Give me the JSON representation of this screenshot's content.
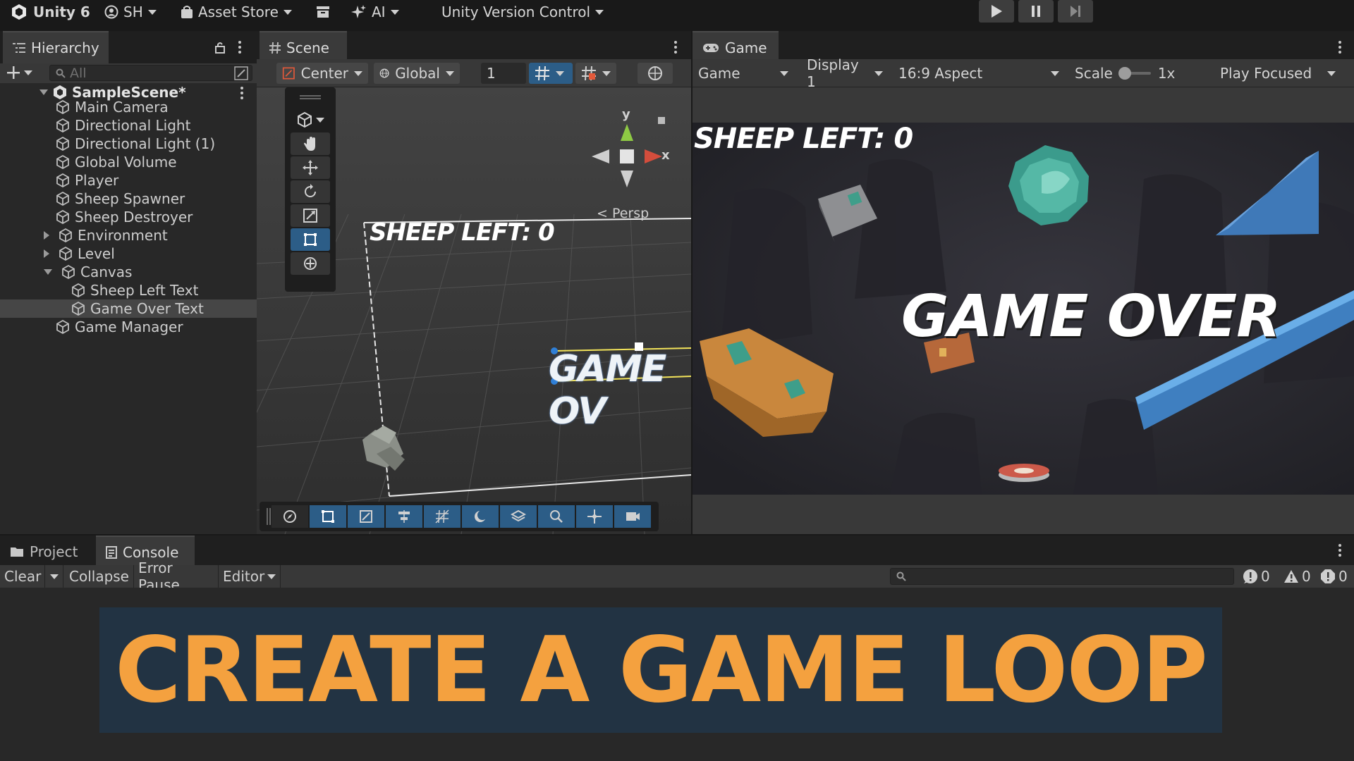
{
  "topbar": {
    "app_label": "Unity 6",
    "account_label": "SH",
    "asset_store_label": "Asset Store",
    "ai_label": "AI",
    "version_control_label": "Unity Version Control"
  },
  "hierarchy": {
    "tab_label": "Hierarchy",
    "search_placeholder": "All",
    "scene_name": "SampleScene*",
    "items": [
      {
        "label": "Main Camera"
      },
      {
        "label": "Directional Light"
      },
      {
        "label": "Directional Light (1)"
      },
      {
        "label": "Global Volume"
      },
      {
        "label": "Player"
      },
      {
        "label": "Sheep Spawner"
      },
      {
        "label": "Sheep Destroyer"
      },
      {
        "label": "Environment"
      },
      {
        "label": "Level"
      },
      {
        "label": "Canvas"
      },
      {
        "label": "Sheep Left Text"
      },
      {
        "label": "Game Over Text"
      },
      {
        "label": "Game Manager"
      }
    ]
  },
  "scene": {
    "tab_label": "Scene",
    "pivot_label": "Center",
    "space_label": "Global",
    "grid_value": "1",
    "persp_label": "< Persp",
    "gizmo_y": "y",
    "gizmo_x": "x",
    "ui_sheep_text": "SHEEP LEFT: 0",
    "ui_gameover_text": "GAME OV"
  },
  "game": {
    "tab_label": "Game",
    "view_label": "Game",
    "display_label": "Display 1",
    "aspect_label": "16:9 Aspect",
    "scale_label": "Scale",
    "scale_value": "1x",
    "play_mode_label": "Play Focused",
    "sheep_left_text": "SHEEP LEFT: 0",
    "game_over_text": "GAME OVER"
  },
  "console": {
    "project_tab_label": "Project",
    "console_tab_label": "Console",
    "clear_label": "Clear",
    "collapse_label": "Collapse",
    "error_pause_label": "Error Pause",
    "editor_label": "Editor",
    "error_count": "0",
    "warning_count": "0",
    "info_count": "0"
  },
  "banner": {
    "text": "CREATE A GAME LOOP"
  },
  "colors": {
    "banner_bg": "#223343",
    "banner_text": "#f4a13f",
    "selection": "#2c5d87"
  }
}
